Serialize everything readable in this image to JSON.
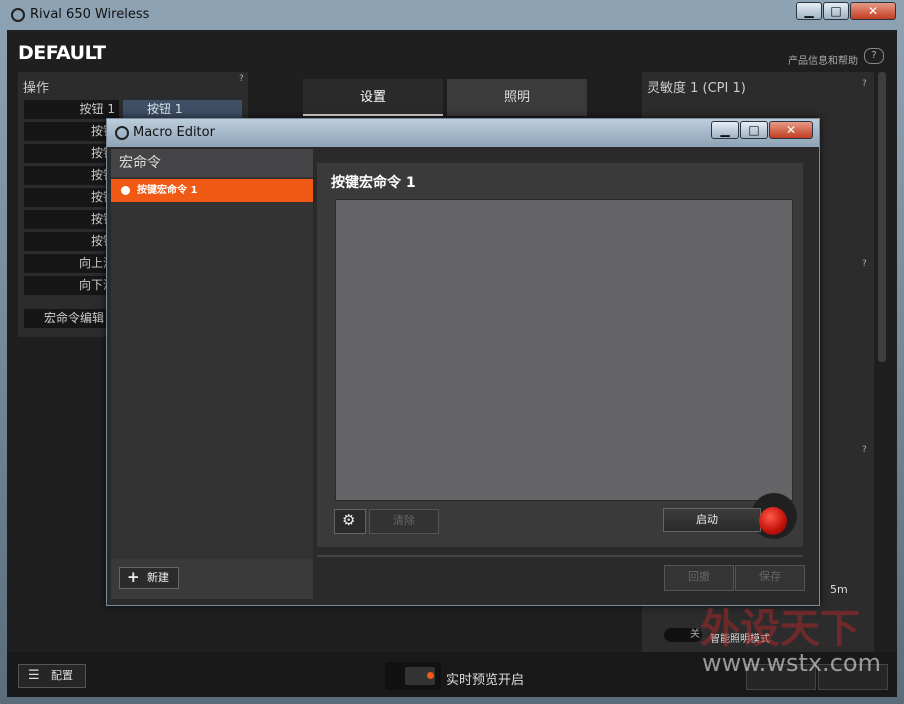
{
  "window": {
    "title": "Rival 650 Wireless",
    "minimize_label": "▁",
    "maximize_label": "□",
    "close_label": "✕"
  },
  "header": {
    "profile_name": "DEFAULT",
    "help_link": "产品信息和帮助",
    "help_icon_glyph": "?"
  },
  "operations": {
    "title": "操作",
    "question": "?",
    "rows": [
      "按钮 1",
      "按钮",
      "按钮",
      "按钮",
      "按钮",
      "按钮",
      "按钮",
      "向上滚",
      "向下滚"
    ],
    "assigned_value": "按钮 1",
    "macro_editor_row": "宏命令编辑"
  },
  "tabs": [
    {
      "label": "设置",
      "active": true
    },
    {
      "label": "照明",
      "active": false
    }
  ],
  "sensitivity": {
    "title": "灵敏度 1 (CPI 1)",
    "question": "?"
  },
  "bottom_bar": {
    "config_label": "配置",
    "live_preview_label": "实时预览开启"
  },
  "lighting_partial": {
    "off_label": "关",
    "smart_mode_label": "智能照明模式",
    "time_label": "5m"
  },
  "dialog": {
    "title": "Macro Editor",
    "left_header": "宏命令",
    "macros": [
      {
        "name": "按键宏命令 1",
        "selected": true
      }
    ],
    "new_label": "新建",
    "right_title": "按键宏命令 1",
    "clear_label": "清除",
    "start_label": "启动",
    "revert_label": "回撤",
    "save_label": "保存"
  },
  "watermark": {
    "text_cn": "外设天下",
    "url": "www.wstx.com"
  },
  "colors": {
    "accent_orange": "#f05a14",
    "record_red": "#c8140c",
    "panel_dark": "#1f1f20"
  }
}
